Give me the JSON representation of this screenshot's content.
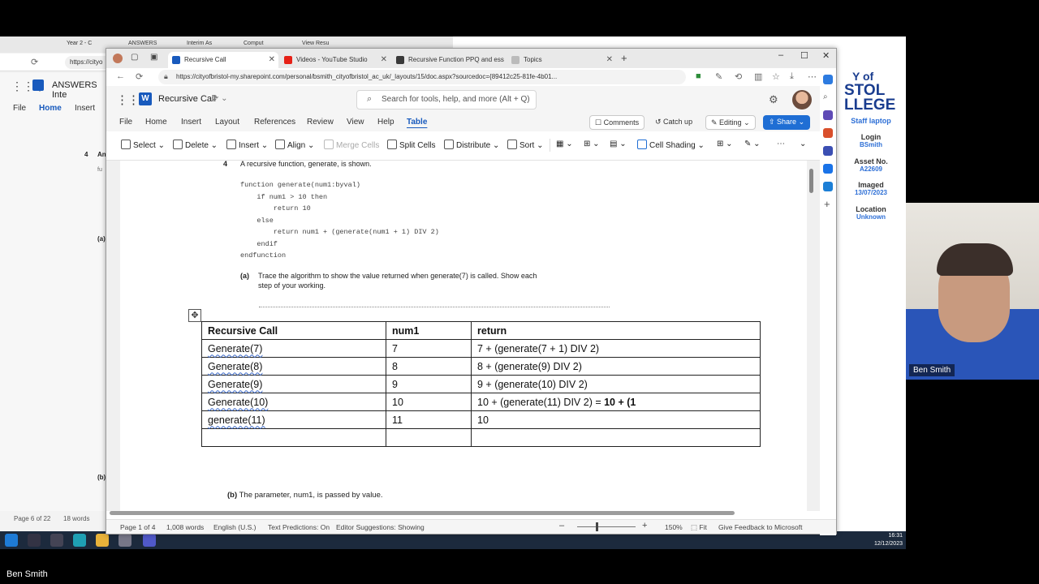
{
  "back_window": {
    "tabs": [
      "Year 2 - C",
      "ANSWERS",
      "Interim As",
      "Comput",
      "View Resu"
    ],
    "url": "https://cityo",
    "word_title": "ANSWERS Inte",
    "menu": [
      "File",
      "Home",
      "Insert"
    ],
    "left_items": [
      "4",
      "An",
      "fu",
      "(a)",
      "(b)"
    ],
    "status_left": "Page 6 of 22",
    "status_words": "18 words"
  },
  "college": {
    "logo_lines": [
      "Y of",
      "STOL",
      "LLEGE"
    ],
    "subtitle": "Staff laptop",
    "fields": [
      {
        "label": "Login",
        "value": "BSmith"
      },
      {
        "label": "Asset No.",
        "value": "A22609"
      },
      {
        "label": "Imaged",
        "value": "13/07/2023"
      },
      {
        "label": "Location",
        "value": "Unknown"
      }
    ]
  },
  "webcam": {
    "name": "Ben Smith"
  },
  "bottom_name": "Ben Smith",
  "taskbar": {
    "time": "16:31",
    "date": "12/12/2023"
  },
  "browser": {
    "tabs": [
      {
        "label": "Recursive Call",
        "icon_color": "#185abd",
        "active": true
      },
      {
        "label": "Videos - YouTube Studio",
        "icon_color": "#e62117",
        "active": false
      },
      {
        "label": "Recursive Function PPQ and ess",
        "icon_color": "#3a3a3a",
        "active": false
      },
      {
        "label": "Topics",
        "icon_color": "#888888",
        "active": false
      }
    ],
    "url": "https://cityofbristol-my.sharepoint.com/personal/bsmith_cityofbristol_ac_uk/_layouts/15/doc.aspx?sourcedoc={89412c25-81fe-4b01..."
  },
  "word": {
    "doc_title": "Recursive Call",
    "search_placeholder": "Search for tools, help, and more (Alt + Q)",
    "menu": [
      "File",
      "Home",
      "Insert",
      "Layout",
      "References",
      "Review",
      "View",
      "Help",
      "Table"
    ],
    "active_menu": "Table",
    "comments": "Comments",
    "catch_up": "Catch up",
    "editing": "Editing",
    "share": "Share",
    "ribbon": [
      "Select",
      "Delete",
      "Insert",
      "Align",
      "Merge Cells",
      "Split Cells",
      "Distribute",
      "Sort",
      "Cell Shading"
    ],
    "accent": "#185abd"
  },
  "document": {
    "q_num": "4",
    "q_intro": "A recursive function, generate, is shown.",
    "code": "function generate(num1:byval)\n    if num1 > 10 then\n        return 10\n    else\n        return num1 + (generate(num1 + 1) DIV 2)\n    endif\nendfunction",
    "part_a_label": "(a)",
    "part_a_text_1": "Trace the algorithm to show the value returned when generate(7) is called. Show each",
    "part_a_text_2": "step of your working.",
    "part_b_label": "(b)",
    "part_b_text": "The parameter, num1, is passed by value.",
    "table": {
      "headers": [
        "Recursive Call",
        "num1",
        "return"
      ],
      "rows": [
        [
          "Generate(7)",
          "7",
          "7 + (generate(7 + 1) DIV 2)",
          ""
        ],
        [
          "Generate(8)",
          "8",
          "8 + (generate(9) DIV 2)",
          ""
        ],
        [
          "Generate(9)",
          "9",
          "9 + (generate(10) DIV 2)",
          ""
        ],
        [
          "Generate(10)",
          "10",
          "10 + (generate(11) DIV 2) = ",
          "10 + (1"
        ],
        [
          "generate(11)",
          "11",
          "10",
          ""
        ],
        [
          "",
          "",
          "",
          ""
        ]
      ]
    }
  },
  "status": {
    "page": "Page 1 of 4",
    "words": "1,008 words",
    "lang": "English (U.S.)",
    "predictions": "Text Predictions: On",
    "editor": "Editor Suggestions: Showing",
    "zoom": "150%",
    "fit": "Fit",
    "feedback": "Give Feedback to Microsoft"
  }
}
